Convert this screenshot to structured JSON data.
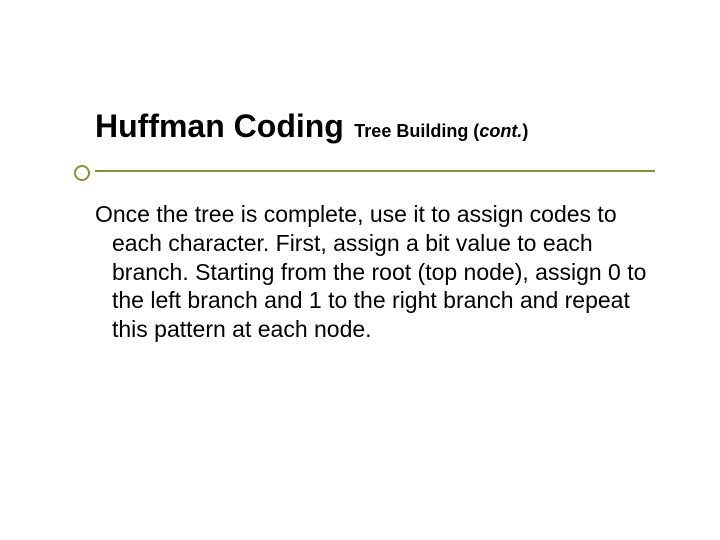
{
  "slide": {
    "title_main": "Huffman Coding",
    "title_sub": "Tree Building (",
    "title_cont": "cont.",
    "title_close": ")",
    "body": "Once the tree is complete, use it to assign codes to each character. First, assign a bit value to each branch. Starting from the root (top node), assign 0 to the left branch and 1 to the right branch and repeat this pattern at each node."
  }
}
